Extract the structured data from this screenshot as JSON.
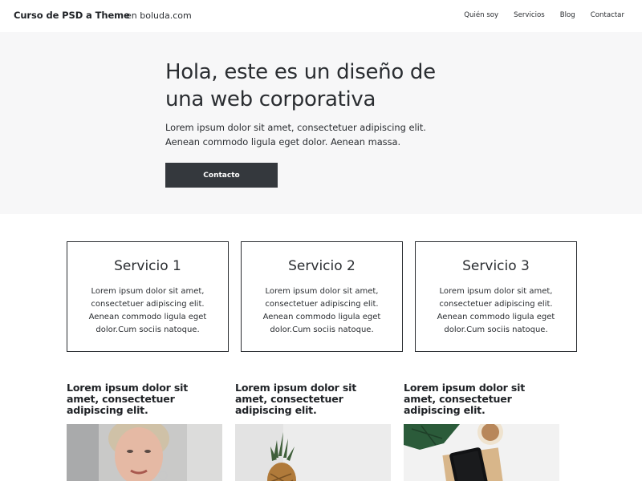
{
  "header": {
    "brand": "Curso de PSD a Theme",
    "tagline": "en boluda.com",
    "nav": [
      "Quién soy",
      "Servicios",
      "Blog",
      "Contactar"
    ]
  },
  "hero": {
    "title": "Hola, este es un diseño de una web corporativa",
    "text": "Lorem ipsum dolor sit amet, consectetuer adipiscing elit. Aenean commodo ligula eget dolor. Aenean massa.",
    "button": "Contacto"
  },
  "services": [
    {
      "title": "Servicio 1",
      "text": "Lorem ipsum dolor sit amet, consectetuer adipiscing elit. Aenean commodo ligula eget dolor.Cum sociis natoque."
    },
    {
      "title": "Servicio 2",
      "text": "Lorem ipsum dolor sit amet, consectetuer adipiscing elit. Aenean commodo ligula eget dolor.Cum sociis natoque."
    },
    {
      "title": "Servicio 3",
      "text": "Lorem ipsum dolor sit amet, consectetuer adipiscing elit. Aenean commodo ligula eget dolor.Cum sociis natoque."
    }
  ],
  "posts": [
    {
      "title": "Lorem ipsum dolor sit amet, consectetuer adipiscing elit.",
      "image": "portrait-photo"
    },
    {
      "title": "Lorem ipsum dolor sit amet, consectetuer adipiscing elit.",
      "image": "pineapple-photo"
    },
    {
      "title": "Lorem ipsum dolor sit amet, consectetuer adipiscing elit.",
      "image": "desk-flatlay-photo"
    }
  ],
  "colors": {
    "text": "#2a2d31",
    "hero_bg": "#f7f7f8",
    "button_bg": "#34383d",
    "button_text": "#ffffff"
  }
}
